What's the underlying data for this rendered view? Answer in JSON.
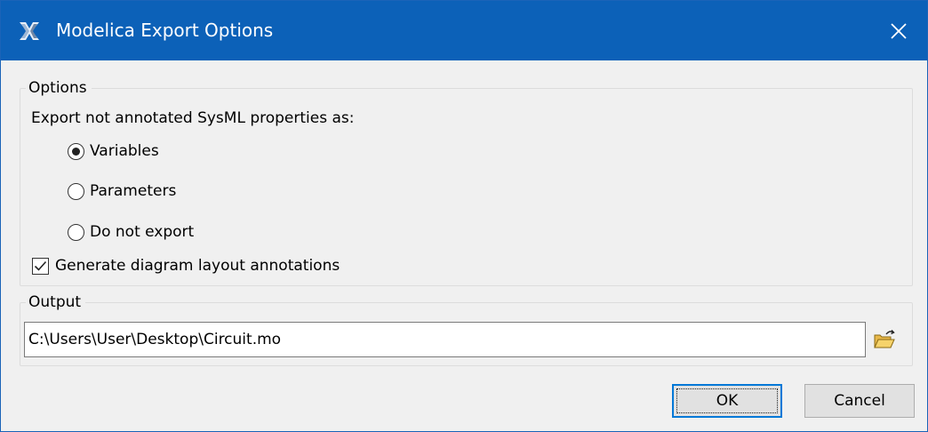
{
  "window": {
    "title": "Modelica Export Options",
    "icon": "magicdraw-app-icon",
    "close_icon": "close-icon"
  },
  "options_group": {
    "legend": "Options",
    "prompt": "Export not annotated SysML properties as:",
    "radio_options": [
      {
        "label": "Variables",
        "selected": true
      },
      {
        "label": "Parameters",
        "selected": false
      },
      {
        "label": "Do not export",
        "selected": false
      }
    ],
    "checkbox": {
      "label": "Generate diagram layout annotations",
      "checked": true
    }
  },
  "output_group": {
    "legend": "Output",
    "path_value": "C:\\Users\\User\\Desktop\\Circuit.mo",
    "browse_icon": "open-folder-icon"
  },
  "buttons": {
    "ok": "OK",
    "cancel": "Cancel"
  },
  "colors": {
    "titlebar": "#0c61b8",
    "accent": "#0078d7",
    "dialog_bg": "#f0f0f0"
  }
}
